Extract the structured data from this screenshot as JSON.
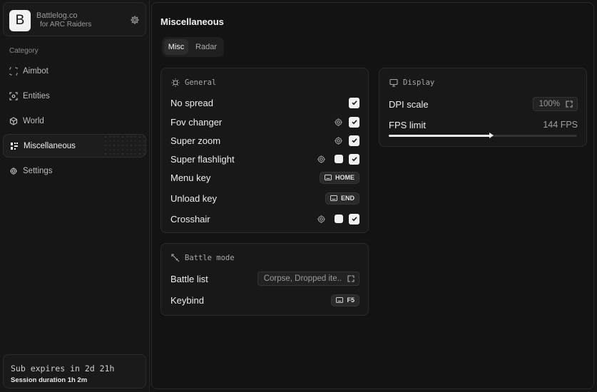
{
  "brand": {
    "logo_letter": "B",
    "name": "Battlelog.co",
    "subtitle": "for ARC Raiders"
  },
  "sidebar": {
    "category_title": "Category",
    "items": [
      {
        "label": "Aimbot",
        "icon": "crosshair-scan-icon",
        "active": false
      },
      {
        "label": "Entities",
        "icon": "entities-icon",
        "active": false
      },
      {
        "label": "World",
        "icon": "cube-icon",
        "active": false
      },
      {
        "label": "Miscellaneous",
        "icon": "grid-icon",
        "active": true
      },
      {
        "label": "Settings",
        "icon": "gear-icon",
        "active": false
      }
    ]
  },
  "subscription": {
    "expires": "Sub expires in 2d 21h",
    "session": "Session duration 1h  2m"
  },
  "main": {
    "title": "Miscellaneous",
    "tabs": [
      {
        "label": "Misc",
        "active": true
      },
      {
        "label": "Radar",
        "active": false
      }
    ]
  },
  "general": {
    "title": "General",
    "rows": {
      "no_spread": "No spread",
      "fov_changer": "Fov changer",
      "super_zoom": "Super zoom",
      "super_flashlight": "Super flashlight",
      "menu_key": "Menu key",
      "menu_key_value": "HOME",
      "unload_key": "Unload key",
      "unload_key_value": "END",
      "crosshair": "Crosshair"
    }
  },
  "battle_mode": {
    "title": "Battle mode",
    "battle_list_label": "Battle list",
    "battle_list_value": "Corpse, Dropped ite..",
    "keybind_label": "Keybind",
    "keybind_value": "F5"
  },
  "display": {
    "title": "Display",
    "dpi_label": "DPI scale",
    "dpi_value": "100%",
    "fps_label": "FPS limit",
    "fps_value": "144 FPS",
    "fps_fraction": 0.55
  },
  "colors": {
    "accent": "#f0f0f0",
    "background": "#141414",
    "card": "#181818"
  }
}
